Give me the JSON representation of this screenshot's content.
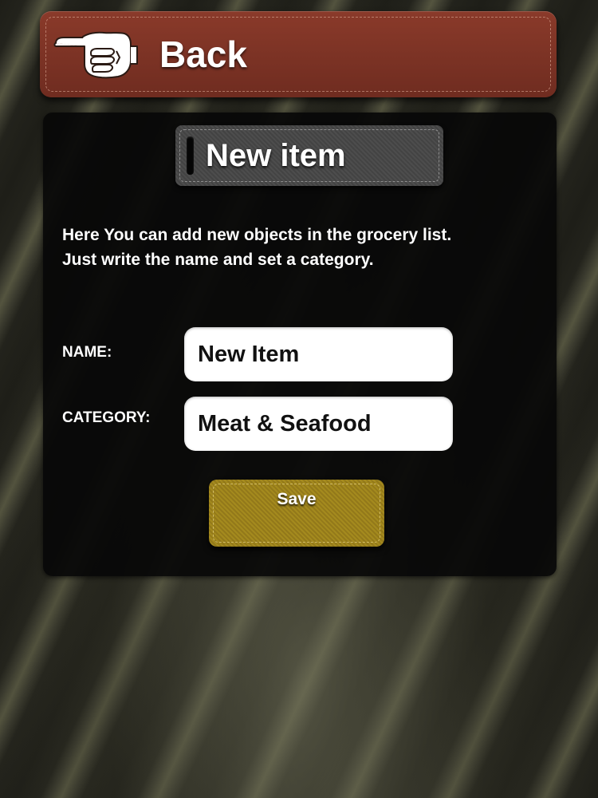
{
  "header": {
    "back_label": "Back",
    "back_icon": "pointing-hand-icon",
    "bar_color": "#7c3326"
  },
  "panel": {
    "title": "New item",
    "description_lines": [
      "Here You can add new objects in the grocery list.",
      "Just write the name and set a category."
    ]
  },
  "form": {
    "name_label": "NAME:",
    "name_value": "New Item",
    "category_label": "CATEGORY:",
    "category_value": "Meat & Seafood",
    "save_label": "Save",
    "save_color": "#a08620"
  }
}
